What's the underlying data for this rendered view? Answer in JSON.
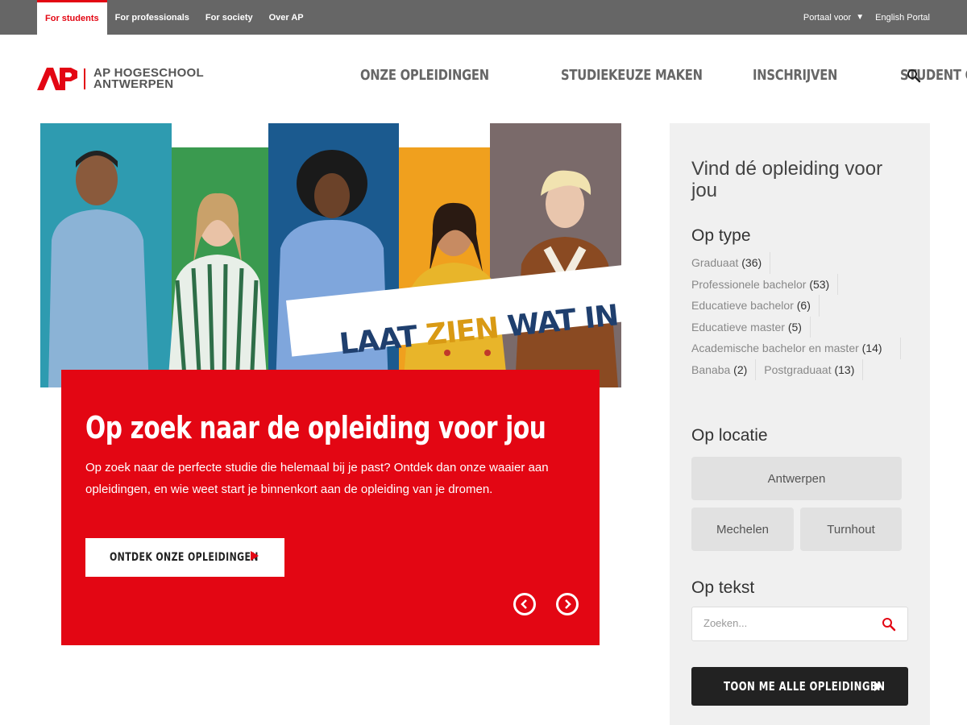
{
  "topbar": {
    "tabs": [
      {
        "label": "For students",
        "active": true
      },
      {
        "label": "For professionals"
      },
      {
        "label": "For society"
      },
      {
        "label": "Over AP"
      }
    ],
    "portal_label": "Portaal voor",
    "english_portal": "English Portal"
  },
  "logo": {
    "mark": "AP",
    "line1": "AP HOGESCHOOL",
    "line2": "ANTWERPEN"
  },
  "nav": {
    "items": [
      "ONZE OPLEIDINGEN",
      "STUDIEKEUZE MAKEN",
      "INSCHRIJVEN",
      "STUDENT CENTER"
    ],
    "search_icon": "search-icon"
  },
  "hero": {
    "slogan_part1": "LAAT",
    "slogan_part2": "ZIEN",
    "slogan_part3": "WAT IN JE ZIT",
    "panel_colors": [
      "#2e9bb0",
      "#3a9a4f",
      "#1b5a8f",
      "#f0a01e",
      "#7a6a6a"
    ]
  },
  "card": {
    "title": "Op zoek naar de opleiding voor jou",
    "description": "Op zoek naar de perfecte studie die helemaal bij je past? Ontdek dan onze waaier aan opleidingen, en wie weet start je binnenkort aan de opleiding van je dromen.",
    "cta_label": "ONTDEK ONZE OPLEIDINGEN"
  },
  "sidebar": {
    "title": "Vind dé opleiding voor jou",
    "type_heading": "Op type",
    "types": [
      {
        "label": "Graduaat",
        "count": "(36)"
      },
      {
        "label": "Professionele bachelor",
        "count": "(53)"
      },
      {
        "label": "Educatieve bachelor",
        "count": "(6)"
      },
      {
        "label": "Educatieve master",
        "count": "(5)"
      },
      {
        "label": "Academische bachelor en master",
        "count": "(14)"
      },
      {
        "label": "Banaba",
        "count": "(2)"
      },
      {
        "label": "Postgraduaat",
        "count": "(13)"
      }
    ],
    "location_heading": "Op locatie",
    "locations": [
      "Antwerpen",
      "Mechelen",
      "Turnhout"
    ],
    "text_heading": "Op tekst",
    "search_placeholder": "Zoeken...",
    "all_button": "TOON ME ALLE OPLEIDINGEN"
  },
  "colors": {
    "brand_red": "#e30613",
    "topbar_gray": "#666666",
    "sidebar_bg": "#f0f0f0"
  }
}
